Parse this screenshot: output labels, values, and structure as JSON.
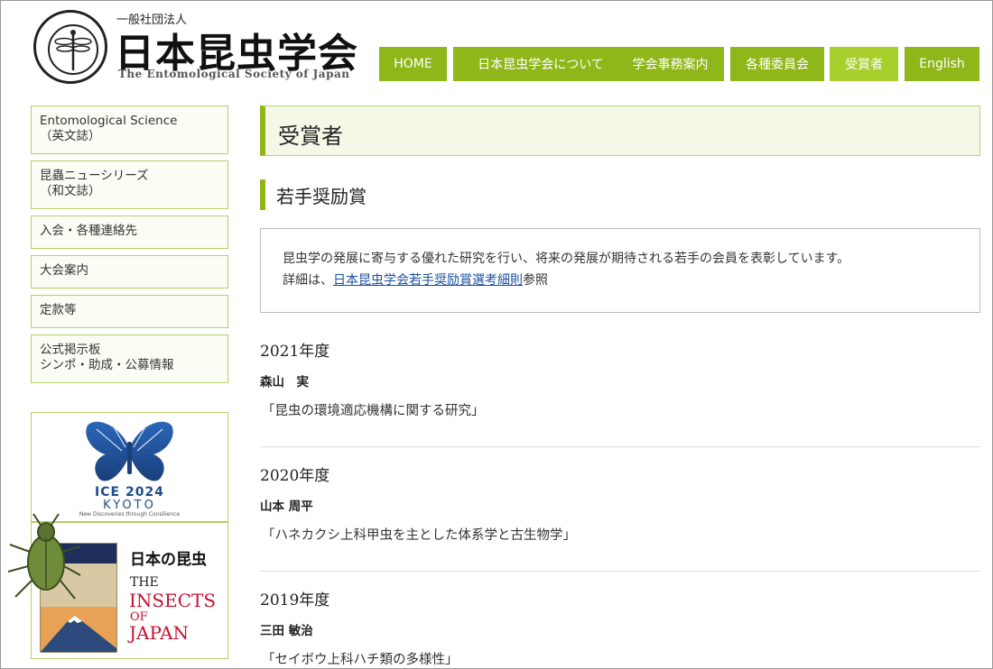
{
  "header": {
    "org_type": "一般社団法人",
    "org_name": "日本昆虫学会",
    "org_name_en": "The Entomological Society of Japan"
  },
  "nav": [
    {
      "label": "HOME",
      "active": false
    },
    {
      "label": "日本昆虫学会について",
      "active": false
    },
    {
      "label": "学会事務案内",
      "active": false
    },
    {
      "label": "各種委員会",
      "active": false
    },
    {
      "label": "受賞者",
      "active": true
    },
    {
      "label": "English",
      "active": false
    }
  ],
  "sidebar": {
    "items": [
      {
        "line1": "Entomological Science",
        "line2": "（英文誌）"
      },
      {
        "line1": "昆蟲ニューシリーズ",
        "line2": "（和文誌）"
      },
      {
        "line1": "入会・各種連絡先",
        "line2": ""
      },
      {
        "line1": "大会案内",
        "line2": ""
      },
      {
        "line1": "定款等",
        "line2": ""
      },
      {
        "line1": "公式掲示板",
        "line2": "シンポ・助成・公募情報"
      }
    ],
    "ice_banner": {
      "title": "ICE 2024",
      "city": "KYOTO",
      "tagline": "New Discoveries through Consilience"
    },
    "insects_banner": {
      "jp_title": "日本の昆虫",
      "en_the": "THE",
      "en_insects": "INSECTS",
      "en_of": "OF",
      "en_japan": "JAPAN"
    }
  },
  "main": {
    "page_title": "受賞者",
    "section_title": "若手奨励賞",
    "intro_line1": "昆虫学の発展に寄与する優れた研究を行い、将来の発展が期待される若手の会員を表彰しています。",
    "intro_prefix": "詳細は、",
    "intro_link": "日本昆虫学会若手奨励賞選考細則",
    "intro_suffix": "参照",
    "awards": [
      {
        "year": "2021年度",
        "winner": "森山　実",
        "topic": "「昆虫の環境適応機構に関する研究」"
      },
      {
        "year": "2020年度",
        "winner": "山本 周平",
        "topic": "「ハネカクシ上科甲虫を主とした体系学と古生物学」"
      },
      {
        "year": "2019年度",
        "winner": "三田 敏治",
        "topic": "「セイボウ上科ハチ類の多様性」"
      }
    ]
  },
  "colors": {
    "accent": "#8fb71a",
    "accent_active": "#a9cf2c",
    "link": "#1a4fa0",
    "ice_blue": "#1f4c8c",
    "insects_red": "#c8102e"
  }
}
